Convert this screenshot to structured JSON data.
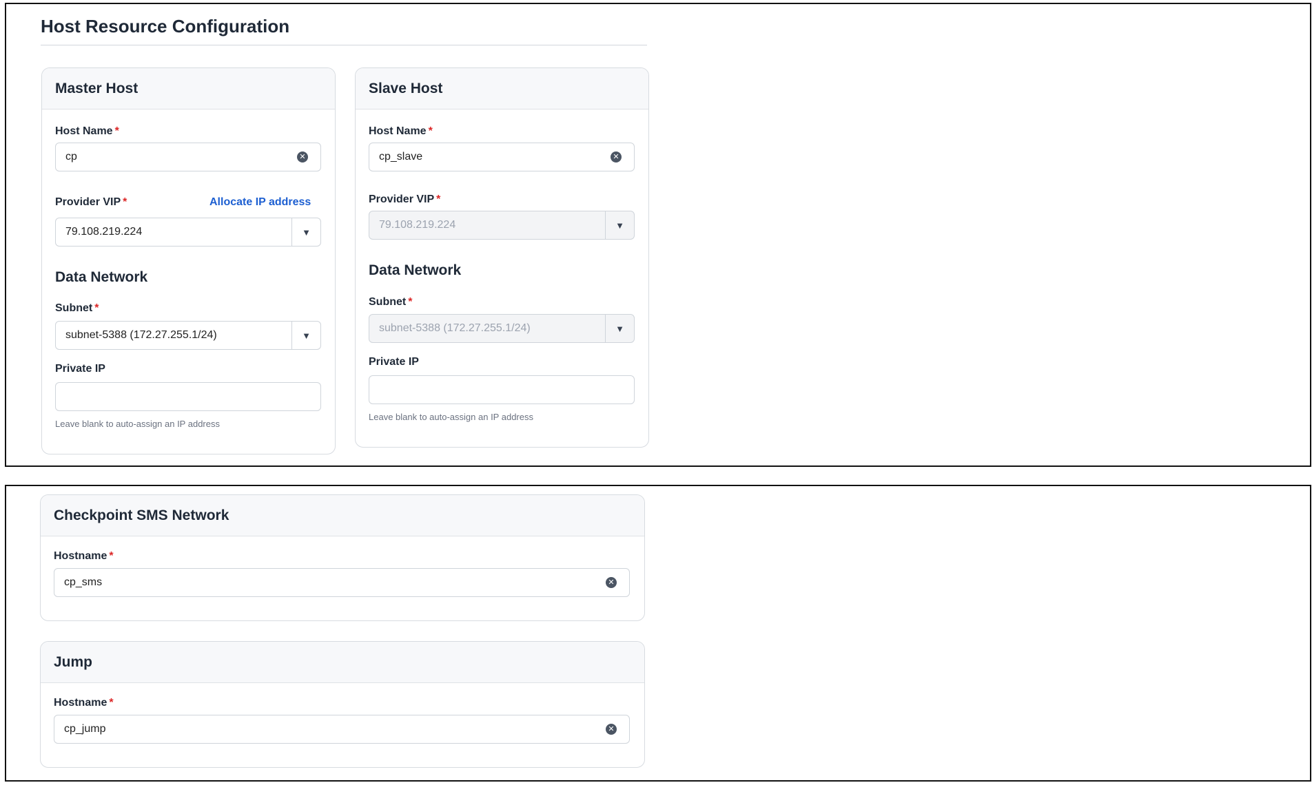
{
  "host_resource": {
    "title": "Host Resource Configuration",
    "master": {
      "title": "Master Host",
      "host_name_label": "Host Name",
      "host_name_value": "cp",
      "provider_vip_label": "Provider VIP",
      "allocate_link": "Allocate IP address",
      "provider_vip_value": "79.108.219.224",
      "data_network_title": "Data Network",
      "subnet_label": "Subnet",
      "subnet_value": "subnet-5388 (172.27.255.1/24)",
      "private_ip_label": "Private IP",
      "private_ip_value": "",
      "private_ip_hint": "Leave blank to auto-assign an IP address"
    },
    "slave": {
      "title": "Slave Host",
      "host_name_label": "Host Name",
      "host_name_value": "cp_slave",
      "provider_vip_label": "Provider VIP",
      "provider_vip_value": "79.108.219.224",
      "data_network_title": "Data Network",
      "subnet_label": "Subnet",
      "subnet_value": "subnet-5388 (172.27.255.1/24)",
      "private_ip_label": "Private IP",
      "private_ip_value": "",
      "private_ip_hint": "Leave blank to auto-assign an IP address"
    }
  },
  "sms_network": {
    "title": "Checkpoint SMS Network",
    "hostname_label": "Hostname",
    "hostname_value": "cp_sms"
  },
  "jump": {
    "title": "Jump",
    "hostname_label": "Hostname",
    "hostname_value": "cp_jump"
  },
  "required_mark": "*",
  "icons": {
    "clear": "clear-icon",
    "dropdown": "chevron-down-icon"
  },
  "colors": {
    "link": "#1d5fd1",
    "required": "#dc2626"
  }
}
